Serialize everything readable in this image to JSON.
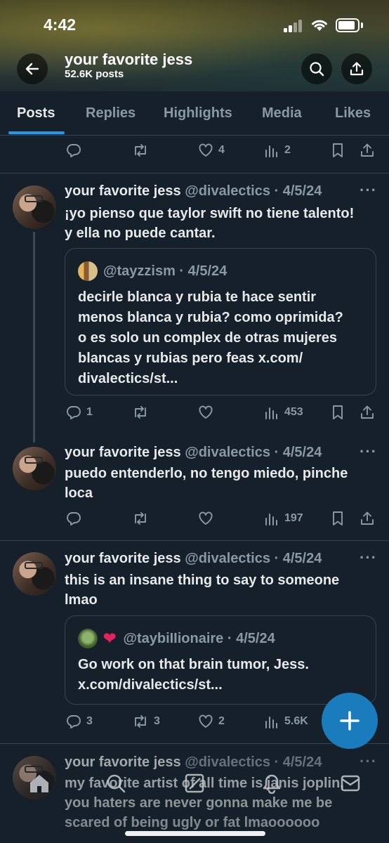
{
  "status_bar": {
    "time": "4:42"
  },
  "header": {
    "name": "your favorite jess",
    "post_count": "52.6K posts"
  },
  "tabs": [
    {
      "label": "Posts",
      "active": true
    },
    {
      "label": "Replies"
    },
    {
      "label": "Highlights"
    },
    {
      "label": "Media"
    },
    {
      "label": "Likes"
    }
  ],
  "partial_post": {
    "likes": "4",
    "views": "2"
  },
  "posts": [
    {
      "name": "your favorite jess",
      "meta": "@divalectics · 4/5/24",
      "text_lines": [
        "¡yo pienso que taylor swift no tiene talento!",
        "y ella no puede cantar."
      ],
      "quote": {
        "handle": "@tayzzism · 4/5/24",
        "text_lines": [
          "decirle blanca y rubia  te hace sentir",
          "menos blanca y rubia? como oprimida?",
          "o es solo un complex de otras mujeres",
          "blancas y rubias pero feas x.com/",
          "divalectics/st..."
        ]
      },
      "replies": "1",
      "reposts": "",
      "likes": "",
      "views": "453"
    },
    {
      "name": "your favorite jess",
      "meta": "@divalectics · 4/5/24",
      "text_lines": [
        "puedo entenderlo, no tengo miedo, pinche",
        "loca"
      ],
      "replies": "",
      "reposts": "",
      "likes": "",
      "views": "197"
    },
    {
      "name": "your favorite jess",
      "meta": "@divalectics · 4/5/24",
      "text_lines": [
        "this is an insane thing to say to someone",
        "lmao"
      ],
      "quote": {
        "handle": "@taybiIIionaire · 4/5/24",
        "text_lines": [
          "Go work on that brain tumor, Jess.",
          "x.com/divalectics/st..."
        ]
      },
      "replies": "3",
      "reposts": "3",
      "likes": "2",
      "views": "5.6K"
    },
    {
      "name": "your favorite jess",
      "meta": "@divalectics · 4/5/24",
      "text_lines": [
        "my favorite artist of all time is janis joplin,",
        "you haters are never gonna make me be",
        "scared of being ugly or fat lmaoooooo"
      ]
    }
  ],
  "colors": {
    "background": "#15202b",
    "accent": "#1d9bf0",
    "secondary_text": "#8b98a5",
    "divider": "#38444d"
  }
}
